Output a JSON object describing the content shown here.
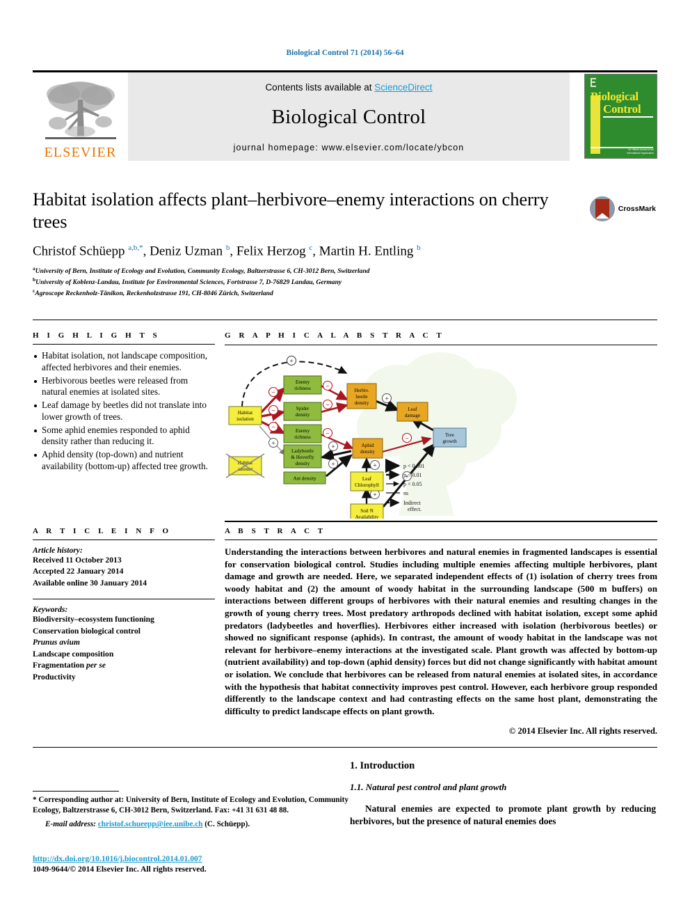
{
  "running_head": "Biological Control 71 (2014) 56–64",
  "masthead": {
    "contents_prefix": "Contents lists available at ",
    "sciencedirect": "ScienceDirect",
    "journal_name": "Biological Control",
    "homepage": "journal homepage: www.elsevier.com/locate/ybcon",
    "publisher": "ELSEVIER",
    "cover_title_line1": "Biological",
    "cover_title_line2": "Control",
    "cover_footer": "An Official Journal of the\nInternational Organization for Biological Control"
  },
  "article": {
    "title": "Habitat isolation affects plant–herbivore–enemy interactions on cherry trees",
    "crossmark_label": "CrossMark",
    "authors_html": "Christof Schüepp <sup>a,b,</sup><sup class=\"star\">*</sup>, Deniz Uzman <sup>b</sup>, Felix Herzog <sup>c</sup>, Martin H. Entling <sup>b</sup>",
    "affiliations": [
      {
        "marker": "a",
        "text": "University of Bern, Institute of Ecology and Evolution, Community Ecology, Baltzerstrasse 6, CH-3012 Bern, Switzerland"
      },
      {
        "marker": "b",
        "text": "University of Koblenz-Landau, Institute for Environmental Sciences, Fortstrasse 7, D-76829 Landau, Germany"
      },
      {
        "marker": "c",
        "text": "Agroscope Reckenholz-Tänikon, Reckenholzstrasse 191, CH-8046 Zürich, Switzerland"
      }
    ]
  },
  "highlights": {
    "heading": "H I G H L I G H T S",
    "items": [
      "Habitat isolation, not landscape composition, affected herbivores and their enemies.",
      "Herbivorous beetles were released from natural enemies at isolated sites.",
      "Leaf damage by beetles did not translate into lower growth of trees.",
      "Some aphid enemies responded to aphid density rather than reducing it.",
      "Aphid density (top-down) and nutrient availability (bottom-up) affected tree growth."
    ]
  },
  "graphical_abstract": {
    "heading": "G R A P H I C A L   A B S T R A C T",
    "nodes": [
      {
        "id": "habitat-isolation",
        "label": "Habitat\nisolation",
        "color": "#f5ee3c"
      },
      {
        "id": "habitat-amount",
        "label": "Habitat\namount",
        "color": "#f5ee3c",
        "crossed_out": true
      },
      {
        "id": "enemy-richness-1",
        "label": "Enemy\nrichness",
        "color": "#8fbb3e"
      },
      {
        "id": "spider-density",
        "label": "Spider\ndensity",
        "color": "#8fbb3e"
      },
      {
        "id": "enemy-richness-2",
        "label": "Enemy\nrichness",
        "color": "#8fbb3e"
      },
      {
        "id": "ladybeetle-hoverfly-density",
        "label": "Ladybeetle\n& Hoverfly\ndensity",
        "color": "#8fbb3e"
      },
      {
        "id": "ant-density",
        "label": "Ant density",
        "color": "#8fbb3e"
      },
      {
        "id": "herbiv-beetle-density",
        "label": "Herbiv.\nbeetle\ndensity",
        "color": "#e8a722"
      },
      {
        "id": "aphid-density",
        "label": "Aphid\ndensity",
        "color": "#e8a722"
      },
      {
        "id": "leaf-damage",
        "label": "Leaf\ndamage",
        "color": "#e8a722"
      },
      {
        "id": "leaf-chlorophyll",
        "label": "Leaf\nChlorophyll",
        "color": "#f5ee3c"
      },
      {
        "id": "soil-n-availability",
        "label": "Soil N\nAvailability",
        "color": "#f5ee3c"
      },
      {
        "id": "tree-growth",
        "label": "Tree\ngrowth",
        "color": "#a8c6da"
      }
    ],
    "legend": [
      {
        "style": "thick-arrow",
        "label": "p < 0.001"
      },
      {
        "style": "medium-arrow",
        "label": "p < 0.01"
      },
      {
        "style": "thin-arrow",
        "label": "p < 0.05"
      },
      {
        "style": "plain-line",
        "label": "ns"
      },
      {
        "style": "dashed-arrow",
        "label": "Indirect\neffect"
      }
    ],
    "sign_plus": "+",
    "sign_minus": "−"
  },
  "article_info": {
    "heading": "A R T I C L E   I N F O",
    "history_label": "Article history:",
    "history": [
      "Received 11 October 2013",
      "Accepted 22 January 2014",
      "Available online 30 January 2014"
    ],
    "keywords_label": "Keywords:",
    "keywords": [
      "Biodiversity–ecosystem functioning",
      "Conservation biological control",
      "Prunus avium",
      "Landscape composition",
      "Fragmentation per se",
      "Productivity"
    ],
    "keywords_italic": {
      "Prunus avium": true,
      "Fragmentation per se": "per se"
    }
  },
  "abstract": {
    "heading": "A B S T R A C T",
    "body": "Understanding the interactions between herbivores and natural enemies in fragmented landscapes is essential for conservation biological control. Studies including multiple enemies affecting multiple herbivores, plant damage and growth are needed. Here, we separated independent effects of (1) isolation of cherry trees from woody habitat and (2) the amount of woody habitat in the surrounding landscape (500 m buffers) on interactions between different groups of herbivores with their natural enemies and resulting changes in the growth of young cherry trees. Most predatory arthropods declined with habitat isolation, except some aphid predators (ladybeetles and hoverflies). Herbivores either increased with isolation (herbivorous beetles) or showed no significant response (aphids). In contrast, the amount of woody habitat in the landscape was not relevant for herbivore–enemy interactions at the investigated scale. Plant growth was affected by bottom-up (nutrient availability) and top-down (aphid density) forces but did not change significantly with habitat amount or isolation. We conclude that herbivores can be released from natural enemies at isolated sites, in accordance with the hypothesis that habitat connectivity improves pest control. However, each herbivore group responded differently to the landscape context and had contrasting effects on the same host plant, demonstrating the difficulty to predict landscape effects on plant growth.",
    "copyright": "© 2014 Elsevier Inc. All rights reserved."
  },
  "introduction": {
    "section_number_title": "1. Introduction",
    "subsection": "1.1. Natural pest control and plant growth",
    "paragraph": "Natural enemies are expected to promote plant growth by reducing herbivores, but the presence of natural enemies does"
  },
  "footer": {
    "corresponding": "* Corresponding author at: University of Bern, Institute of Ecology and Evolution, Community Ecology, Baltzerstrasse 6, CH-3012 Bern, Switzerland. Fax: +41 31 631 48 88.",
    "email_label": "E-mail address:",
    "email": "christof.schueepp@iee.unibe.ch",
    "email_suffix": "(C. Schüepp).",
    "doi": "http://dx.doi.org/10.1016/j.biocontrol.2014.01.007",
    "issn_copyright": "1049-9644/© 2014 Elsevier Inc. All rights reserved."
  },
  "colors": {
    "link_blue": "#1a9ad1",
    "runhead_blue": "#1a6fa8",
    "elsevier_orange": "#E77500",
    "cover_green": "#2e8b2e",
    "negative_red": "#b5121b",
    "tree_bg": "#eaf2e0"
  }
}
